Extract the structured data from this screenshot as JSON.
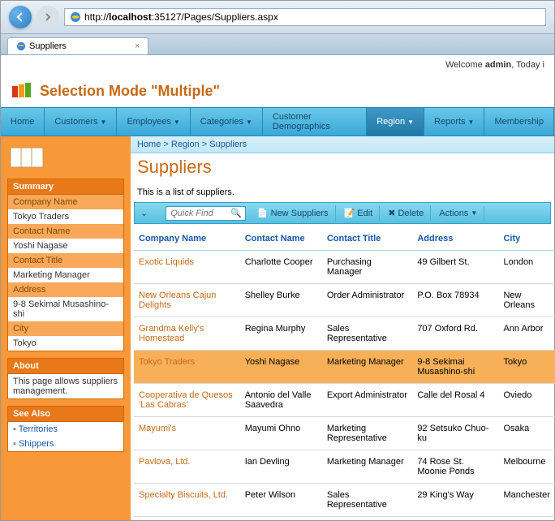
{
  "browser": {
    "url_prefix": "http://",
    "url_host": "localhost",
    "url_rest": ":35127/Pages/Suppliers.aspx",
    "tab_title": "Suppliers"
  },
  "welcome": {
    "prefix": "Welcome ",
    "user": "admin",
    "suffix": ", Today i"
  },
  "page_title": "Selection Mode \"Multiple\"",
  "nav": {
    "home": "Home",
    "customers": "Customers",
    "employees": "Employees",
    "categories": "Categories",
    "demographics": "Customer Demographics",
    "region": "Region",
    "reports": "Reports",
    "membership": "Membership"
  },
  "sidebar": {
    "summary_head": "Summary",
    "fields": [
      {
        "label": "Company Name",
        "value": "Tokyo Traders"
      },
      {
        "label": "Contact Name",
        "value": "Yoshi Nagase"
      },
      {
        "label": "Contact Title",
        "value": "Marketing Manager"
      },
      {
        "label": "Address",
        "value": "9-8 Sekimai Musashino-shi"
      },
      {
        "label": "City",
        "value": "Tokyo"
      }
    ],
    "about_head": "About",
    "about_text": "This page allows suppliers management.",
    "seealso_head": "See Also",
    "links": [
      "Territories",
      "Shippers"
    ]
  },
  "crumbs": {
    "c1": "Home",
    "c2": "Region",
    "c3": "Suppliers"
  },
  "main_title": "Suppliers",
  "sub_text": "This is a list of suppliers.",
  "toolbar": {
    "quick_find": "Quick Find",
    "new": "New Suppliers",
    "edit": "Edit",
    "delete": "Delete",
    "actions": "Actions"
  },
  "columns": {
    "c1": "Company Name",
    "c2": "Contact Name",
    "c3": "Contact Title",
    "c4": "Address",
    "c5": "City"
  },
  "rows": [
    {
      "company": "Exotic Liquids",
      "contact": "Charlotte Cooper",
      "title": "Purchasing Manager",
      "address": "49 Gilbert St.",
      "city": "London",
      "sel": false
    },
    {
      "company": "New Orleans Cajun Delights",
      "contact": "Shelley Burke",
      "title": "Order Administrator",
      "address": "P.O. Box 78934",
      "city": "New Orleans",
      "sel": false
    },
    {
      "company": "Grandma Kelly's Homestead",
      "contact": "Regina Murphy",
      "title": "Sales Representative",
      "address": "707 Oxford Rd.",
      "city": "Ann Arbor",
      "sel": false
    },
    {
      "company": "Tokyo Traders",
      "contact": "Yoshi Nagase",
      "title": "Marketing Manager",
      "address": "9-8 Sekimai Musashino-shi",
      "city": "Tokyo",
      "sel": true
    },
    {
      "company": "Cooperativa de Quesos 'Las Cabras'",
      "contact": "Antonio del Valle Saavedra",
      "title": "Export Administrator",
      "address": "Calle del Rosal 4",
      "city": "Oviedo",
      "sel": false
    },
    {
      "company": "Mayumi's",
      "contact": "Mayumi Ohno",
      "title": "Marketing Representative",
      "address": "92 Setsuko Chuo-ku",
      "city": "Osaka",
      "sel": false
    },
    {
      "company": "Pavlova, Ltd.",
      "contact": "Ian Devling",
      "title": "Marketing Manager",
      "address": "74 Rose St. Moonie Ponds",
      "city": "Melbourne",
      "sel": false
    },
    {
      "company": "Specialty Biscuits, Ltd.",
      "contact": "Peter Wilson",
      "title": "Sales Representative",
      "address": "29 King's Way",
      "city": "Manchester",
      "sel": false
    }
  ]
}
